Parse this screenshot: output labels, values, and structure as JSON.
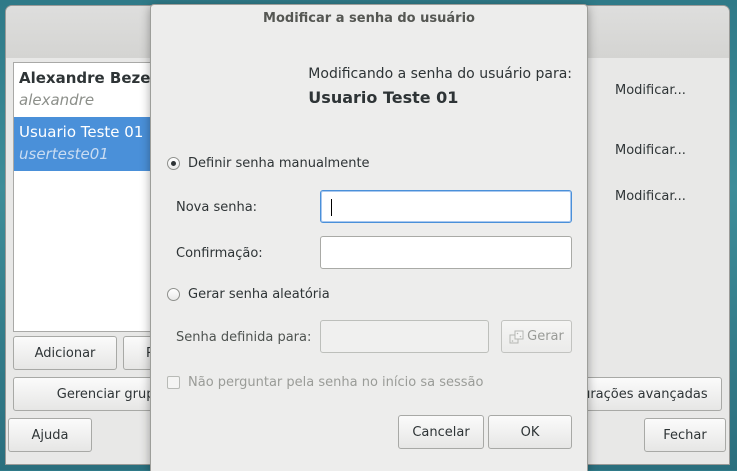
{
  "parent_window": {
    "users": [
      {
        "name": "Alexandre Bezerra",
        "login": "alexandre"
      },
      {
        "name": "Usuario Teste 01",
        "login": "userteste01"
      }
    ],
    "modify_links": [
      "Modificar...",
      "Modificar...",
      "Modificar..."
    ],
    "buttons": {
      "add": "Adicionar",
      "remove": "Remover",
      "manage_groups": "Gerenciar grupos",
      "advanced": "Configurações avançadas",
      "help": "Ajuda",
      "close": "Fechar"
    }
  },
  "dialog": {
    "title": "Modificar a senha do usuário",
    "intro_line": "Modificando a senha do usuário para:",
    "intro_user": "Usuario Teste 01",
    "radio_manual": "Definir senha manualmente",
    "radio_manual_selected": true,
    "new_password_label": "Nova senha:",
    "new_password_value": "",
    "confirm_label": "Confirmação:",
    "confirm_value": "",
    "radio_random": "Gerar senha aleatória",
    "radio_random_selected": false,
    "set_password_label": "Senha definida para:",
    "set_password_value": "",
    "generate_button": "Gerar",
    "dont_ask_checkbox": "Não perguntar pela senha no início sa sessão",
    "dont_ask_checked": false,
    "cancel_button": "Cancelar",
    "ok_button": "OK"
  }
}
